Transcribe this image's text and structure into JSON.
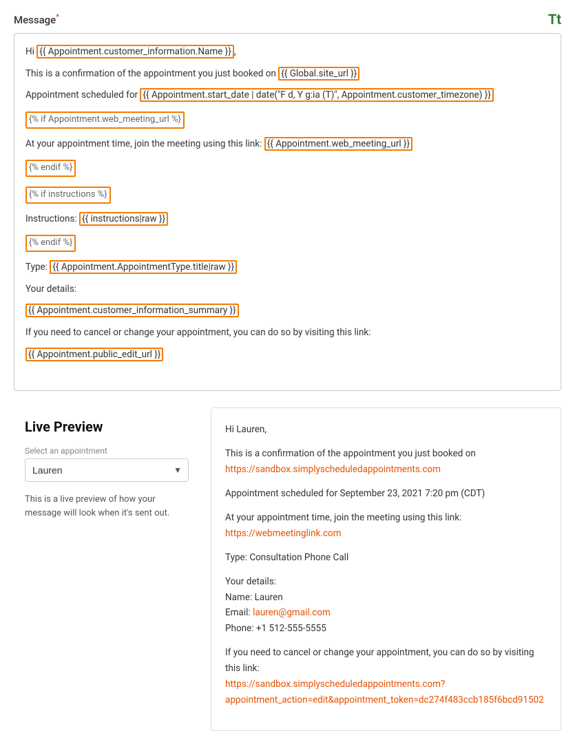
{
  "message_section": {
    "label": "Message",
    "required_marker": "*",
    "tt_icon_label": "Tt",
    "lines": [
      {
        "id": "line1",
        "text": "Hi ",
        "tag": "{{ Appointment.customer_information.Name }}",
        "suffix": ","
      },
      {
        "id": "line2",
        "text": "This is a confirmation of the appointment you just booked on ",
        "tag": "{{ Global.site_url }}"
      },
      {
        "id": "line3",
        "text": "Appointment scheduled for ",
        "tag": "{{ Appointment.start_date | date(\"F d, Y g:ia (T)\", Appointment.customer_timezone) }}"
      },
      {
        "id": "line4",
        "block": "{% if Appointment.web_meeting_url %}"
      },
      {
        "id": "line5",
        "text": "At your appointment time, join the meeting using this link: ",
        "tag": "{{ Appointment.web_meeting_url }}"
      },
      {
        "id": "line6",
        "block": "{% endif %}"
      },
      {
        "id": "line7",
        "block": "{% if instructions %}"
      },
      {
        "id": "line8",
        "text": "Instructions: ",
        "tag": "{{ instructions|raw }}"
      },
      {
        "id": "line9",
        "block": "{% endif %}"
      },
      {
        "id": "line10",
        "text": "Type: ",
        "tag": "{{ Appointment.AppointmentType.title|raw }}"
      },
      {
        "id": "line11",
        "text": "Your details:"
      },
      {
        "id": "line12",
        "tag": "{{ Appointment.customer_information_summary }}"
      },
      {
        "id": "line13",
        "text": "If you need to cancel or change your appointment, you can do so by visiting this link:"
      },
      {
        "id": "line14",
        "tag": "{{ Appointment.public_edit_url }}"
      }
    ]
  },
  "live_preview": {
    "title": "Live Preview",
    "select_label": "Select an appointment",
    "select_value": "Lauren",
    "select_options": [
      "Lauren"
    ],
    "description": "This is a live preview of how your message will look when it's sent out.",
    "preview": {
      "greeting": "Hi Lauren,",
      "line1_text": "This is a confirmation of the appointment you just booked on",
      "line1_link": "https://sandbox.simplyscheduledappointments.com",
      "line2": "Appointment scheduled for September 23, 2021 7:20 pm (CDT)",
      "line3_text": "At your appointment time, join the meeting using this link:",
      "line3_link": "https://webmeetinglink.com",
      "line4": "Type: Consultation Phone Call",
      "line5": "Your details:",
      "line6": "Name: Lauren",
      "line7_text": "Email:",
      "line7_link": "lauren@gmail.com",
      "line8": "Phone: +1 512-555-5555",
      "line9_text": "If you need to cancel or change your appointment, you can do so by visiting this link:",
      "line9_link": "https://sandbox.simplyscheduledappointments.com?appointment_action=edit&appointment_token=dc274f483ccb185f6bcd91502"
    }
  }
}
